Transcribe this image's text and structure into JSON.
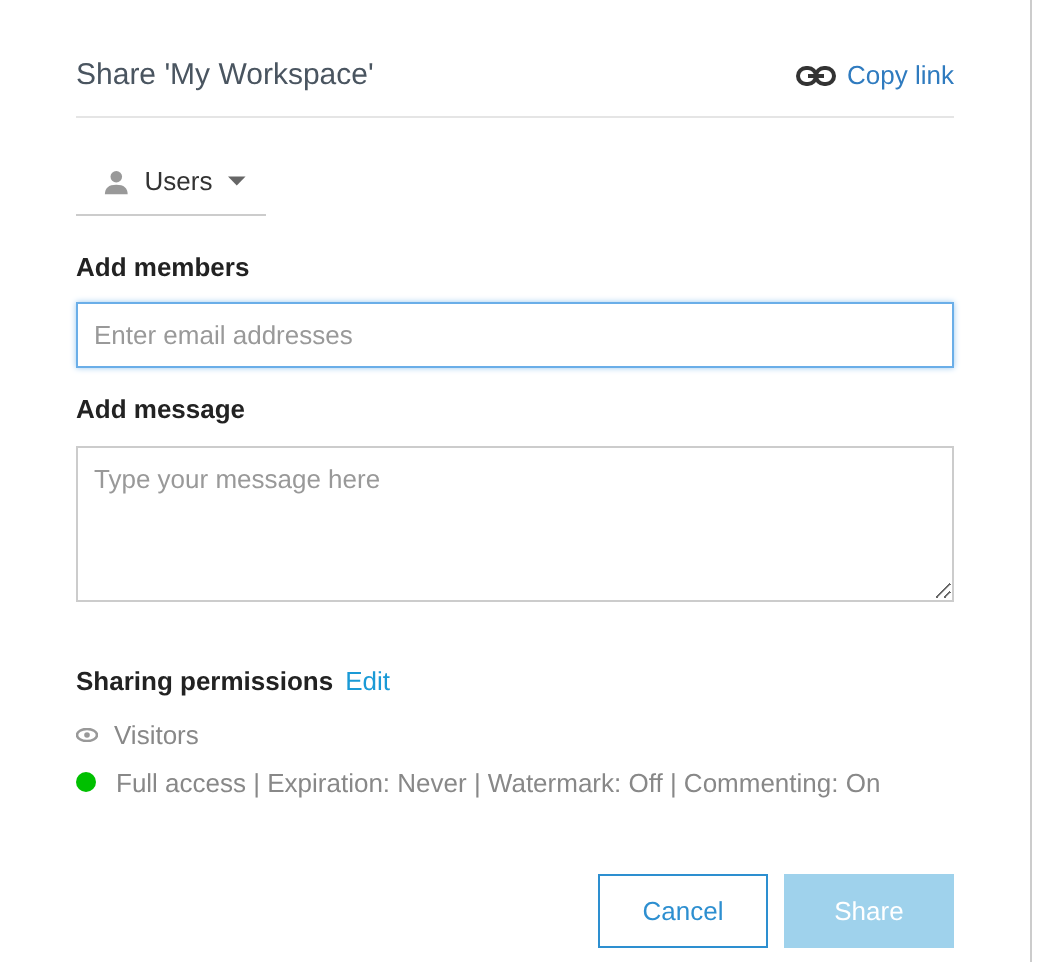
{
  "dialog": {
    "title": "Share 'My Workspace'",
    "copy_link": "Copy link"
  },
  "audience_dropdown": {
    "label": "Users"
  },
  "add_members": {
    "label": "Add members",
    "placeholder": "Enter email addresses"
  },
  "add_message": {
    "label": "Add message",
    "placeholder": "Type your message here"
  },
  "sharing_permissions": {
    "label": "Sharing permissions",
    "edit": "Edit",
    "role": "Visitors",
    "summary": "Full access | Expiration: Never | Watermark: Off | Commenting: On"
  },
  "buttons": [
    {
      "label": "Cancel",
      "kind": "secondary",
      "disabled": false
    },
    {
      "label": "Share",
      "kind": "primary",
      "disabled": true
    }
  ]
}
